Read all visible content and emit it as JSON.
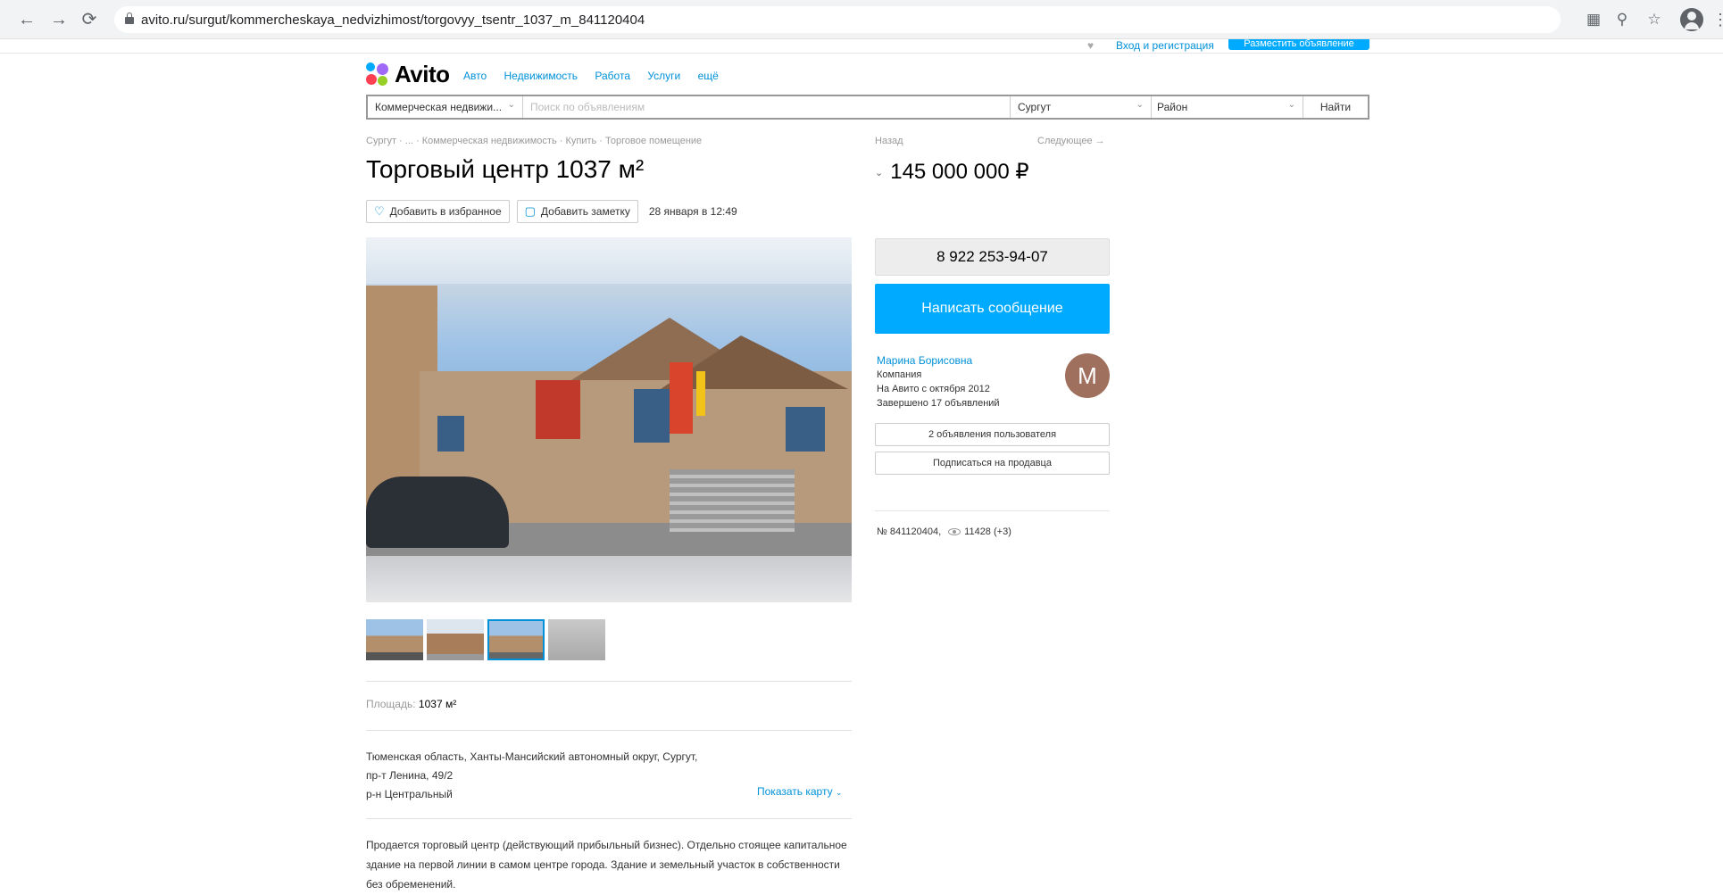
{
  "browser": {
    "url": "avito.ru/surgut/kommercheskaya_nedvizhimost/torgovyy_tsentr_1037_m_841120404"
  },
  "header": {
    "logo": "Avito",
    "nav": [
      "Авто",
      "Недвижимость",
      "Работа",
      "Услуги",
      "ещё"
    ],
    "login_text": "Вход и регистрация",
    "post_button": "Разместить объявление"
  },
  "search": {
    "category": "Коммерческая недвижи...",
    "query_placeholder": "Поиск по объявлениям",
    "city": "Сургут",
    "district": "Район",
    "find_button": "Найти"
  },
  "listing": {
    "breadcrumb": "Сургут · ... · Коммерческая недвижимость · Купить · Торговое помещение",
    "title": "Торговый центр 1037 м²",
    "favorite_button": "Добавить в избранное",
    "note_button": "Добавить заметку",
    "date": "28 января в 12:49",
    "area_label": "Площадь:",
    "area_value": "1037 м²",
    "address_line1": "Тюменская область, Ханты-Мансийский автономный округ, Сургут,",
    "address_line2": "пр-т Ленина, 49/2",
    "address_line3": "р-н Центральный",
    "map_link": "Показать карту",
    "description": "Продается торговый центр (действующий прибыльный бизнес). Отдельно стоящее капитальное здание на первой линии в самом центре города. Здание и земельный участок в собственности без обременений."
  },
  "sidebar": {
    "back": "Назад",
    "next": "Следующее →",
    "price": "145 000 000 ₽",
    "phone": "8 922 253-94-07",
    "message_button": "Написать сообщение",
    "seller_name": "Марина Борисовна",
    "seller_type": "Компания",
    "seller_since": "На Авито с октября 2012",
    "seller_completed": "Завершено 17 объявлений",
    "avatar_letter": "М",
    "user_ads_button": "2 объявления пользователя",
    "subscribe_button": "Подписаться на продавца",
    "item_number": "№ 841120404,",
    "views": "11428 (+3)"
  }
}
